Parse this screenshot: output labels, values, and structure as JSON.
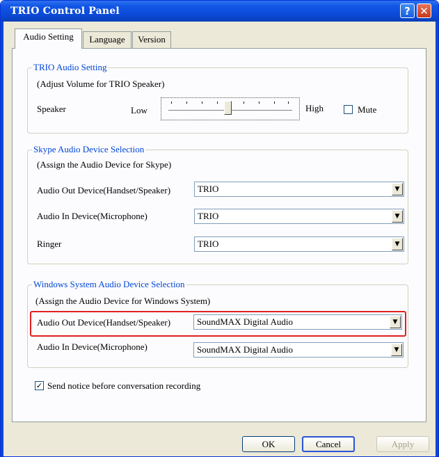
{
  "window": {
    "title": "TRIO Control Panel"
  },
  "titlebar": {
    "help_glyph": "?",
    "close_glyph": "✕"
  },
  "tabs": [
    {
      "label": "Audio Setting"
    },
    {
      "label": "Language"
    },
    {
      "label": "Version"
    }
  ],
  "trio_audio": {
    "legend": "TRIO Audio Setting",
    "hint": "(Adjust Volume for TRIO Speaker)",
    "speaker_label": "Speaker",
    "low_label": "Low",
    "high_label": "High",
    "mute_label": "Mute",
    "mute_checked": false,
    "volume_level": 0.5
  },
  "skype_audio": {
    "legend": "Skype Audio Device Selection",
    "hint": "(Assign the Audio Device for Skype)",
    "rows": [
      {
        "label": "Audio Out Device(Handset/Speaker)",
        "value": "TRIO"
      },
      {
        "label": "Audio In Device(Microphone)",
        "value": "TRIO"
      },
      {
        "label": "Ringer",
        "value": "TRIO"
      }
    ]
  },
  "windows_audio": {
    "legend": "Windows System Audio Device Selection",
    "hint": "(Assign the Audio Device for Windows System)",
    "rows": [
      {
        "label": "Audio Out Device(Handset/Speaker)",
        "value": "SoundMAX Digital Audio"
      },
      {
        "label": "Audio In Device(Microphone)",
        "value": "SoundMAX Digital Audio"
      }
    ]
  },
  "notice": {
    "label": "Send notice before conversation recording",
    "checked": true,
    "check_glyph": "✓"
  },
  "dropdown_arrow": "▼",
  "buttons": {
    "ok": "OK",
    "cancel": "Cancel",
    "apply": "Apply"
  },
  "colors": {
    "titlebar": "#0a46d4",
    "legend": "#0046d5",
    "highlight": "#e02020"
  }
}
